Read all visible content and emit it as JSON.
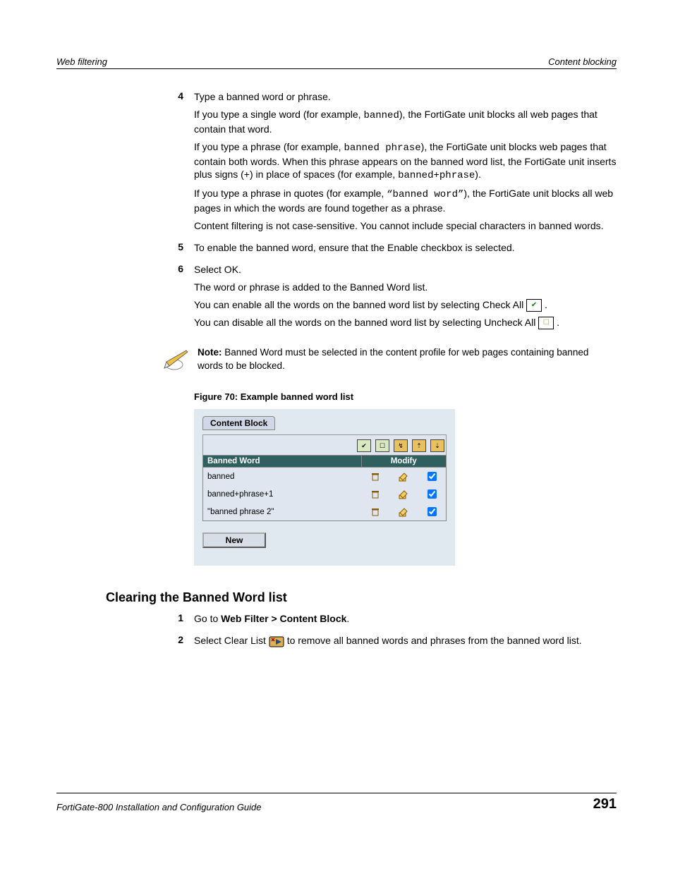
{
  "header": {
    "left": "Web filtering",
    "right": "Content blocking"
  },
  "steps_a": [
    {
      "n": "4",
      "paras": [
        "Type a banned word or phrase.",
        "If you type a single word (for example, <code>banned</code>), the FortiGate unit blocks all web pages that contain that word.",
        "If you type a phrase (for example, <code>banned phrase</code>), the FortiGate unit blocks web pages that contain both words. When this phrase appears on the banned word list, the FortiGate unit inserts plus signs (+) in place of spaces (for example, <code>banned+phrase</code>).",
        "If you type a phrase in quotes (for example, <code>“banned word”</code>), the FortiGate unit blocks all web pages in which the words are found together as a phrase.",
        "Content filtering is not case-sensitive. You cannot include special characters in banned words."
      ]
    },
    {
      "n": "5",
      "paras": [
        "To enable the banned word, ensure that the Enable checkbox is selected."
      ]
    },
    {
      "n": "6",
      "paras": [
        "Select OK.",
        "The word or phrase is added to the Banned Word list.",
        "You can enable all the words on the banned word list by selecting Check All <span class=\"icon-box check\">✔</span> .",
        "You can disable all the words on the banned word list by selecting Uncheck All <span class=\"icon-box uncheck\">☐</span> ."
      ]
    }
  ],
  "note": {
    "label": "Note:",
    "text": " Banned Word must be selected in the content profile for web pages containing banned words to be blocked."
  },
  "figure": {
    "caption": "Figure 70: Example banned word list",
    "tab": "Content Block",
    "col1": "Banned Word",
    "col2": "Modify",
    "rows": [
      {
        "word": "banned",
        "checked": true
      },
      {
        "word": "banned+phrase+1",
        "checked": true
      },
      {
        "word": "\"banned phrase 2\"",
        "checked": true
      }
    ],
    "new_label": "New"
  },
  "section2": {
    "title": "Clearing the Banned Word list",
    "steps": [
      {
        "n": "1",
        "html": "Go to <b>Web Filter > Content Block</b>."
      },
      {
        "n": "2",
        "html": "Select Clear List <span class=\"clear-icon\"><svg viewBox=\"0 0 22 18\"><rect x=\"1\" y=\"3\" width=\"20\" height=\"14\" rx=\"2\" fill=\"#e0b050\" stroke=\"#000\"/><polygon points=\"10,6 18,10 10,14\" fill=\"#205080\"/><path d=\"M4,5 L8,9 M8,5 L4,9\" stroke=\"#a00\" stroke-width=\"1.5\"/></svg></span> to remove all banned words and phrases from the banned word list."
      }
    ]
  },
  "footer": {
    "guide": "FortiGate-800 Installation and Configuration Guide",
    "page": "291"
  }
}
